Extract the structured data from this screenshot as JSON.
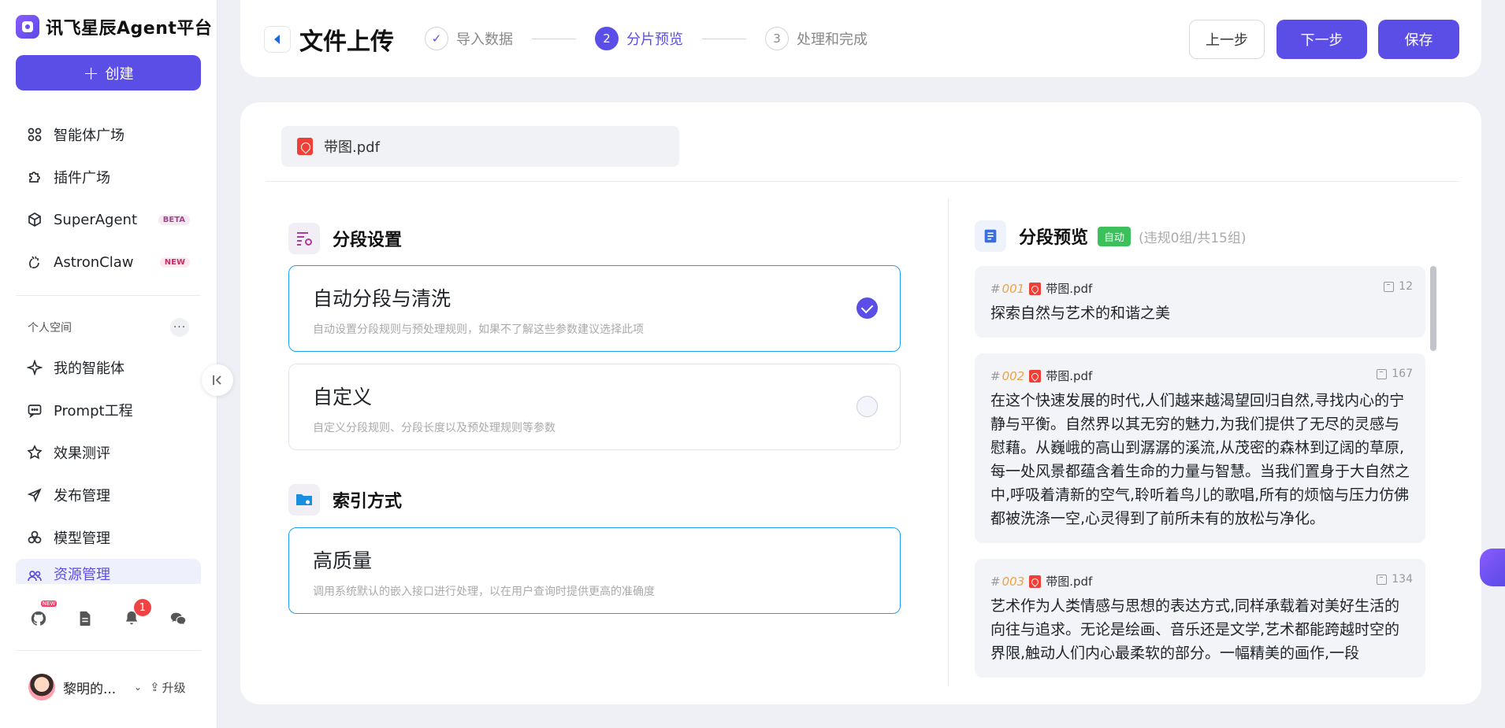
{
  "sidebar": {
    "brand": "讯飞星辰Agent平台",
    "create_label": "创建",
    "nav_main": [
      {
        "label": "智能体广场",
        "icon": "grid-icon"
      },
      {
        "label": "插件广场",
        "icon": "puzzle-icon"
      },
      {
        "label": "SuperAgent",
        "icon": "cube-icon",
        "tag": "BETA"
      },
      {
        "label": "AstronClaw",
        "icon": "claw-icon",
        "tag": "NEW"
      }
    ],
    "section_label": "个人空间",
    "section_more": "···",
    "nav_personal": [
      {
        "label": "我的智能体",
        "icon": "sparkle-icon"
      },
      {
        "label": "Prompt工程",
        "icon": "prompt-icon"
      },
      {
        "label": "效果测评",
        "icon": "evaluate-icon"
      },
      {
        "label": "发布管理",
        "icon": "send-icon"
      },
      {
        "label": "模型管理",
        "icon": "model-icon"
      },
      {
        "label": "资源管理",
        "icon": "users-icon"
      }
    ],
    "bottom": {
      "github_new": "NEW",
      "notif_count": "1"
    },
    "user": {
      "name": "黎明的...",
      "upgrade": "升级"
    }
  },
  "header": {
    "title": "文件上传",
    "steps": [
      {
        "num": "✓",
        "label": "导入数据",
        "state": "done"
      },
      {
        "num": "2",
        "label": "分片预览",
        "state": "active"
      },
      {
        "num": "3",
        "label": "处理和完成",
        "state": "todo"
      }
    ],
    "prev_label": "上一步",
    "next_label": "下一步",
    "save_label": "保存"
  },
  "file_tab": {
    "name": "带图.pdf"
  },
  "segment": {
    "title": "分段设置",
    "options": [
      {
        "title": "自动分段与清洗",
        "desc": "自动设置分段规则与预处理规则，如果不了解这些参数建议选择此项",
        "selected": true
      },
      {
        "title": "自定义",
        "desc": "自定义分段规则、分段长度以及预处理规则等参数",
        "selected": false
      }
    ]
  },
  "index": {
    "title": "索引方式",
    "option": {
      "title": "高质量",
      "desc": "调用系统默认的嵌入接口进行处理，以在用户查询时提供更高的准确度"
    }
  },
  "preview": {
    "title": "分段预览",
    "badge": "自动",
    "stats": "(违规0组/共15组)",
    "chunks": [
      {
        "hash": "#",
        "no": "001",
        "file": "带图.pdf",
        "count": "12",
        "text": "探索自然与艺术的和谐之美"
      },
      {
        "hash": "#",
        "no": "002",
        "file": "带图.pdf",
        "count": "167",
        "text": "在这个快速发展的时代,人们越来越渴望回归自然,寻找内心的宁静与平衡。自然界以其无穷的魅力,为我们提供了无尽的灵感与慰藉。从巍峨的高山到潺潺的溪流,从茂密的森林到辽阔的草原,每一处风景都蕴含着生命的力量与智慧。当我们置身于大自然之中,呼吸着清新的空气,聆听着鸟儿的歌唱,所有的烦恼与压力仿佛都被洗涤一空,心灵得到了前所未有的放松与净化。"
      },
      {
        "hash": "#",
        "no": "003",
        "file": "带图.pdf",
        "count": "134",
        "text": "艺术作为人类情感与思想的表达方式,同样承载着对美好生活的向往与追求。无论是绘画、音乐还是文学,艺术都能跨越时空的界限,触动人们内心最柔软的部分。一幅精美的画作,一段"
      }
    ]
  },
  "colors": {
    "accent": "#5b4ee6",
    "selected_border": "#1f9ff0",
    "auto_badge": "#3cc05b"
  }
}
